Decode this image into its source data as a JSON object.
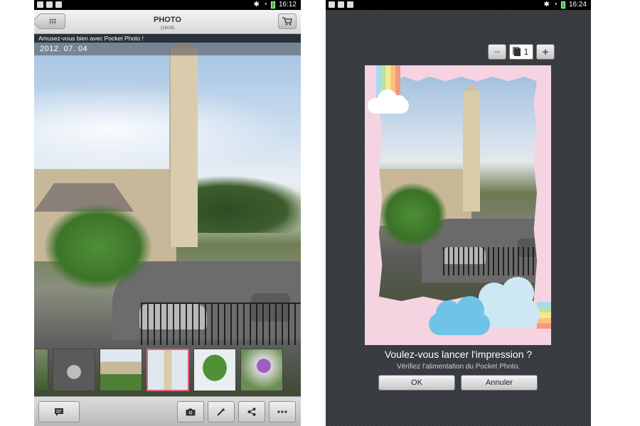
{
  "left": {
    "status": {
      "time": "16:12"
    },
    "header": {
      "title": "PHOTO",
      "counter": "(16/18)"
    },
    "caption": "Amusez-vous bien avec Pocket Photo !",
    "date": "2012. 07. 04",
    "thumbnails": [
      "thumb-partial",
      "thumb-cat",
      "thumb-house",
      "thumb-tower",
      "thumb-tree",
      "thumb-flowers"
    ],
    "toolbar": {
      "icons": [
        "comment-icon",
        "camera-icon",
        "magic-wand-icon",
        "share-icon",
        "more-icon"
      ]
    },
    "colors": {
      "selected_border": "#e35b87"
    }
  },
  "right": {
    "status": {
      "time": "16:24"
    },
    "quantity": {
      "value": "1",
      "minus": "−",
      "plus": "+"
    },
    "dialog": {
      "title": "Voulez-vous lancer l'impression ?",
      "subtitle": "Vérifiez l'alimentation du Pocket Photo.",
      "ok_label": "OK",
      "cancel_label": "Annuler"
    },
    "colors": {
      "frame": "#f6d3e0",
      "cloud_blue": "#6fc3e6"
    }
  }
}
